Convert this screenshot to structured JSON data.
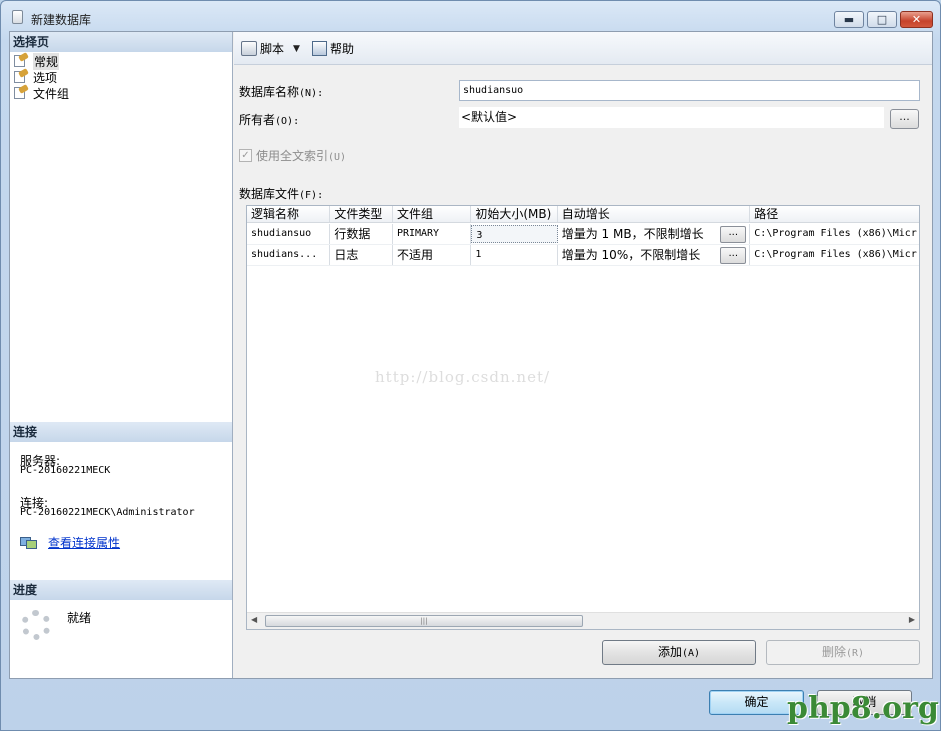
{
  "window": {
    "title": "新建数据库",
    "controls": {
      "minimize": "▬",
      "maximize": "□",
      "close": "✕"
    }
  },
  "left_panel": {
    "select_page_header": "选择页",
    "nav_items": [
      {
        "label": "常规",
        "icon": "page-settings-icon",
        "selected": true
      },
      {
        "label": "选项",
        "icon": "page-settings-icon",
        "selected": false
      },
      {
        "label": "文件组",
        "icon": "page-settings-icon",
        "selected": false
      }
    ],
    "connection_header": "连接",
    "server_label": "服务器:",
    "server_value": "PC-20160221MECK",
    "connection_label": "连接:",
    "connection_value": "PC-20160221MECK\\Administrator",
    "view_properties_link": "查看连接属性",
    "progress_header": "进度",
    "progress_status": "就绪"
  },
  "toolbar": {
    "script_label": "脚本",
    "help_label": "帮助"
  },
  "form": {
    "db_name_label": "数据库名称",
    "db_name_hotkey": "(N):",
    "db_name_value": "shudiansuo",
    "owner_label": "所有者",
    "owner_hotkey": "(O):",
    "owner_value": "<默认值>",
    "browse_label": "...",
    "fulltext_label": "使用全文索引",
    "fulltext_hotkey": "(U)",
    "fulltext_checked": true,
    "db_files_label": "数据库文件",
    "db_files_hotkey": "(F):"
  },
  "grid": {
    "columns": [
      "逻辑名称",
      "文件类型",
      "文件组",
      "初始大小(MB)",
      "自动增长",
      "路径"
    ],
    "rows": [
      {
        "logical_name": "shudiansuo",
        "file_type": "行数据",
        "filegroup": "PRIMARY",
        "initial_size": "3",
        "autogrowth": "增量为 1 MB，不限制增长",
        "path": "C:\\Program Files (x86)\\Micr"
      },
      {
        "logical_name": "shudians...",
        "file_type": "日志",
        "filegroup": "不适用",
        "initial_size": "1",
        "autogrowth": "增量为 10%，不限制增长",
        "path": "C:\\Program Files (x86)\\Micr"
      }
    ],
    "ellipsis": "...",
    "watermark": "http://blog.csdn.net/"
  },
  "buttons": {
    "add_label": "添加",
    "add_hotkey": "(A)",
    "remove_label": "删除",
    "remove_hotkey": "(R)",
    "ok_label": "确定",
    "cancel_label": "取消"
  },
  "brand_watermark": "php8.org"
}
